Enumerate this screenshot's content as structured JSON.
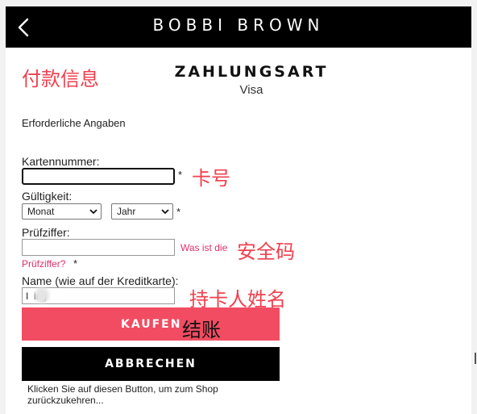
{
  "header": {
    "brand": "BOBBI BROWN",
    "back_icon": "chevron-left-icon"
  },
  "page": {
    "title": "ZAHLUNGSART",
    "subtitle": "Visa",
    "required_note": "Erforderliche Angaben"
  },
  "annotations": {
    "payment_info": "付款信息",
    "card_number": "卡号",
    "security_code": "安全码",
    "cardholder_name": "持卡人姓名",
    "checkout": "结账"
  },
  "form": {
    "card_number": {
      "label": "Kartennummer:",
      "value": "",
      "required_mark": "*"
    },
    "expiry": {
      "label": "Gültigkeit:",
      "month": "Monat",
      "year": "Jahr",
      "required_mark": "*"
    },
    "security_code": {
      "label": "Prüfziffer:",
      "value": "",
      "help_link_line1": "Was ist die",
      "help_link_line2": "Prüfziffer?",
      "required_mark": "*"
    },
    "name": {
      "label": "Name (wie auf der Kreditkarte):",
      "value": "I  ing"
    }
  },
  "buttons": {
    "buy": "KAUFEN",
    "cancel": "ABBRECHEN"
  },
  "cancel_hint": "Klicken Sie auf diesen Button, um zum Shop zurückzukehren...",
  "colors": {
    "accent": "#f14c62",
    "annotation": "#f0404e",
    "link": "#e0306a",
    "header": "#000000"
  }
}
